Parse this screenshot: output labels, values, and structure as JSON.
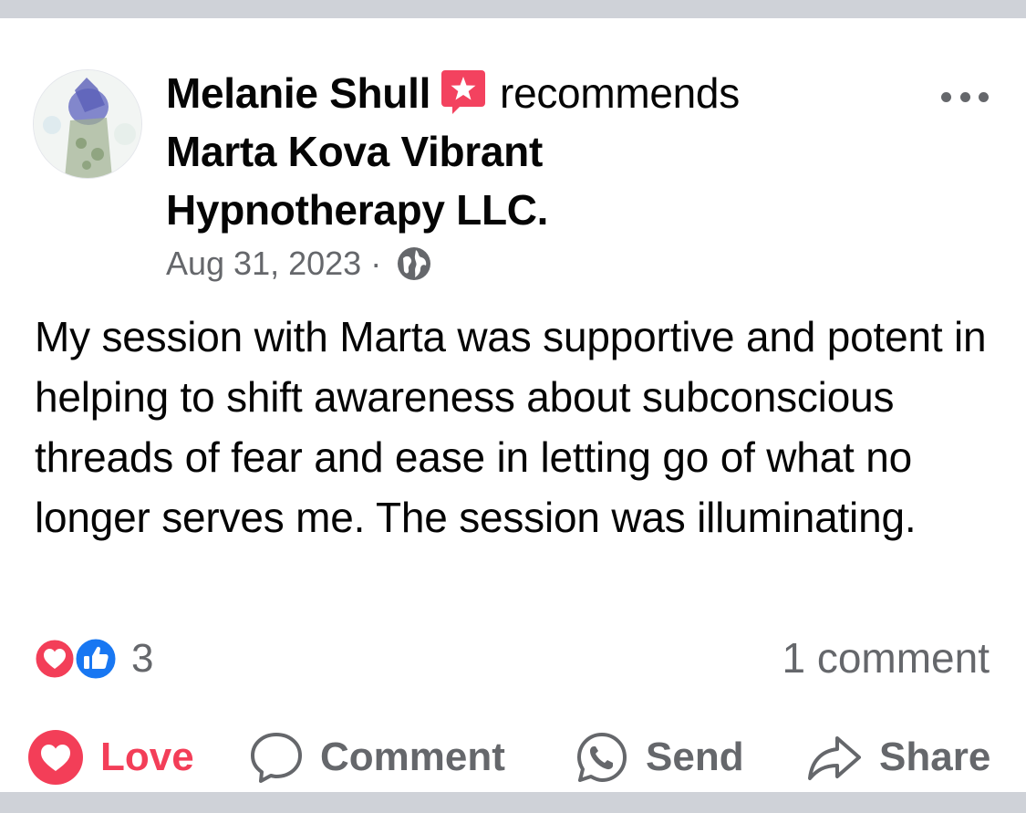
{
  "post": {
    "author": "Melanie Shull",
    "action": "recommends",
    "page_line1": "Marta Kova Vibrant",
    "page_line2": "Hypnotherapy LLC.",
    "date": "Aug 31, 2023",
    "separator": "·",
    "audience_icon": "globe-icon",
    "text": "My session with Marta was supportive and potent in helping to shift awareness about subconscious threads of fear and ease in letting go of what no longer serves me. The session was illuminating."
  },
  "stats": {
    "reaction_count": "3",
    "reaction_icons": [
      "heart-love-icon",
      "thumbs-up-like-icon"
    ],
    "comments": "1 comment"
  },
  "actions": {
    "love": "Love",
    "comment": "Comment",
    "send": "Send",
    "share": "Share"
  },
  "colors": {
    "love": "#f33e58",
    "like": "#1877f2",
    "recommend": "#f3425f",
    "secondary_text": "#65676b"
  }
}
